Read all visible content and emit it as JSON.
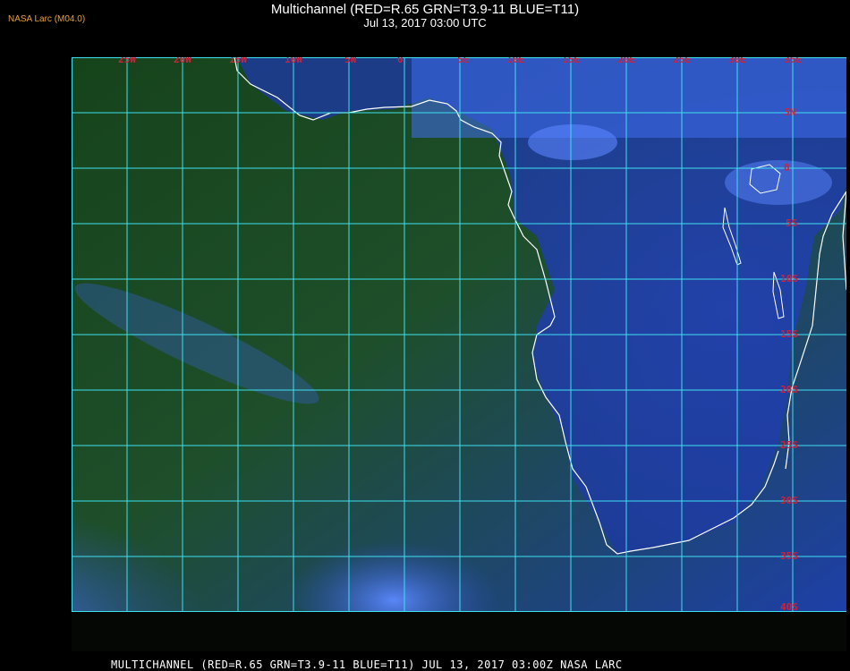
{
  "header": {
    "title": "Multichannel (RED=R.65 GRN=T3.9-11 BLUE=T11)",
    "subtitle": "Jul 13, 2017 03:00 UTC",
    "org": "NASA Larc (M04.0)"
  },
  "footer": {
    "text": "MULTICHANNEL (RED=R.65 GRN=T3.9-11 BLUE=T11) JUL 13, 2017 03:00Z   NASA LARC"
  },
  "map": {
    "longitude_labels": [
      "25W",
      "20W",
      "15W",
      "10W",
      "5W",
      "0",
      "5E",
      "10E",
      "15E",
      "20E",
      "25E",
      "30E",
      "35E"
    ],
    "latitude_labels": [
      "5N",
      "0",
      "5S",
      "10S",
      "15S",
      "20S",
      "25S",
      "30S",
      "35S",
      "40S"
    ],
    "colors": {
      "grid": "#3fe0f0",
      "coastline": "#ffffff",
      "labels": "#d0203a",
      "cloud": "#4a7bff",
      "clear_ocean": "#1d4a1e"
    }
  }
}
